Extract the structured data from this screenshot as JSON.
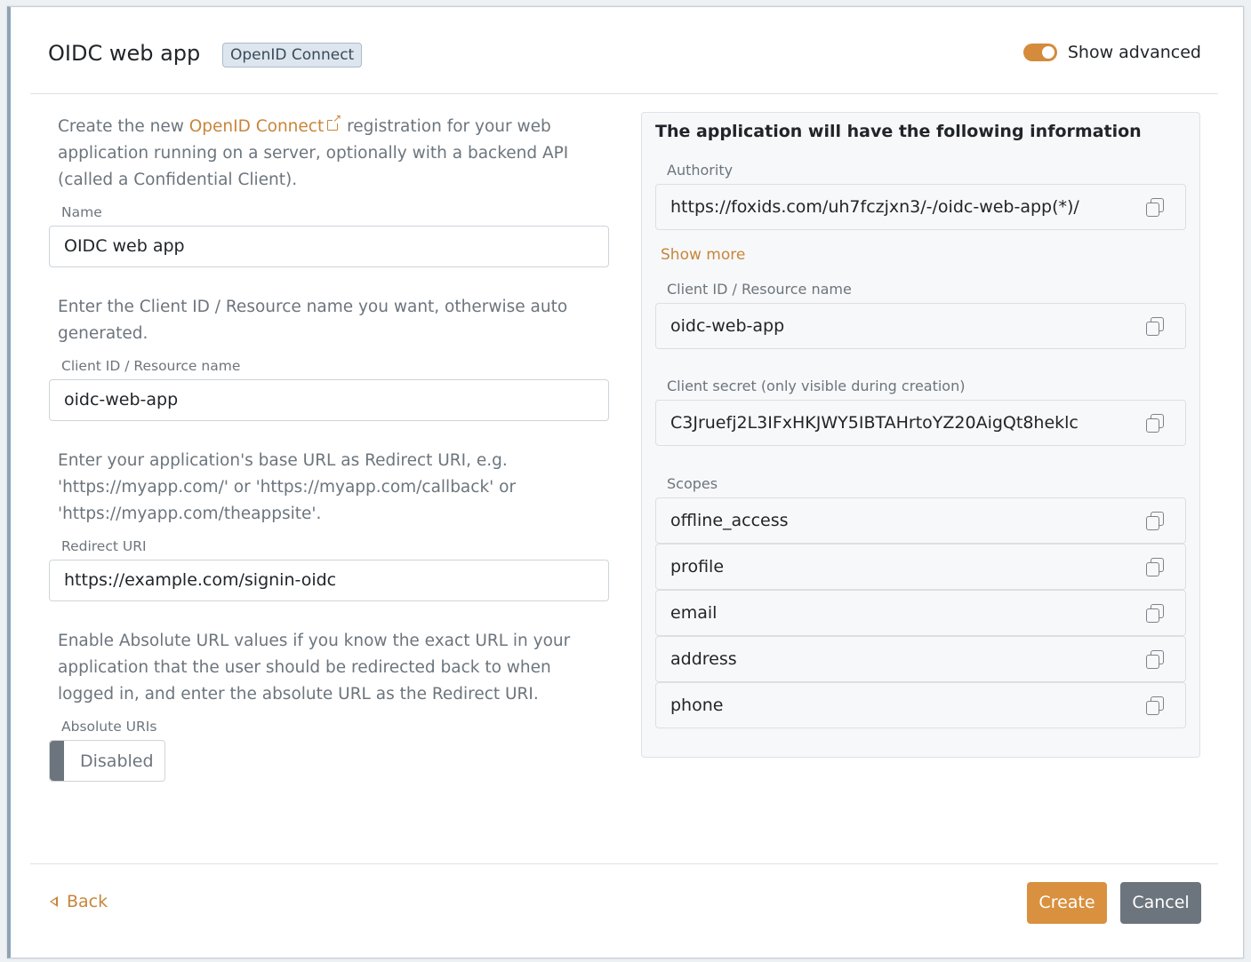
{
  "header": {
    "title": "OIDC web app",
    "badge": "OpenID Connect",
    "show_advanced_label": "Show advanced",
    "show_advanced_on": true,
    "accent_color": "#d48b3b"
  },
  "form": {
    "intro_before": "Create the new ",
    "intro_link": "OpenID Connect",
    "intro_after": " registration for your web application running on a server, optionally with a backend API (called a Confidential Client).",
    "name_label": "Name",
    "name_value": "OIDC web app",
    "client_id_help": "Enter the Client ID / Resource name you want, otherwise auto generated.",
    "client_id_label": "Client ID / Resource name",
    "client_id_value": "oidc-web-app",
    "redirect_help": "Enter your application's base URL as Redirect URI, e.g. 'https://myapp.com/' or 'https://myapp.com/callback' or 'https://myapp.com/theappsite'.",
    "redirect_label": "Redirect URI",
    "redirect_value": "https://example.com/signin-oidc",
    "absolute_help": "Enable Absolute URL values if you know the exact URL in your application that the user should be redirected back to when logged in, and enter the absolute URL as the Redirect URI.",
    "absolute_label": "Absolute URIs",
    "absolute_value": "Disabled"
  },
  "info": {
    "title": "The application will have the following information",
    "authority_label": "Authority",
    "authority_value": "https://foxids.com/uh7fczjxn3/-/oidc-web-app(*)/",
    "show_more": "Show more",
    "client_id_label": "Client ID / Resource name",
    "client_id_value": "oidc-web-app",
    "secret_label": "Client secret (only visible during creation)",
    "secret_value": "C3Jruefj2L3IFxHKJWY5IBTAHrtoYZ20AigQt8heklc",
    "scopes_label": "Scopes",
    "scopes": [
      "offline_access",
      "profile",
      "email",
      "address",
      "phone"
    ]
  },
  "footer": {
    "back_label": "Back",
    "create_label": "Create",
    "cancel_label": "Cancel"
  }
}
